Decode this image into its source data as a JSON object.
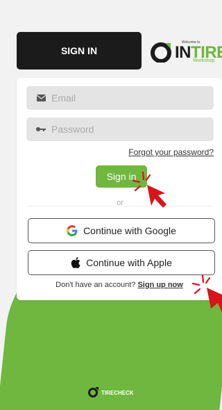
{
  "header": {
    "signin_tab": "SIGN IN",
    "logo": {
      "welcome": "Welcome to",
      "brand_in": "IN",
      "brand_tire": "TIRE",
      "sub": "Workshop"
    }
  },
  "form": {
    "email_placeholder": "Email",
    "password_placeholder": "Password",
    "forgot": "Forgot your password?",
    "signin_button": "Sign in",
    "or": "or",
    "google": "Continue with Google",
    "apple": "Continue with Apple",
    "no_account": "Don't have an account?",
    "signup": "Sign up now"
  },
  "footer": {
    "brand": "TIRECHECK"
  },
  "colors": {
    "accent": "#6fb73f",
    "dark": "#1b1b1b",
    "cursor": "#d9141b"
  }
}
